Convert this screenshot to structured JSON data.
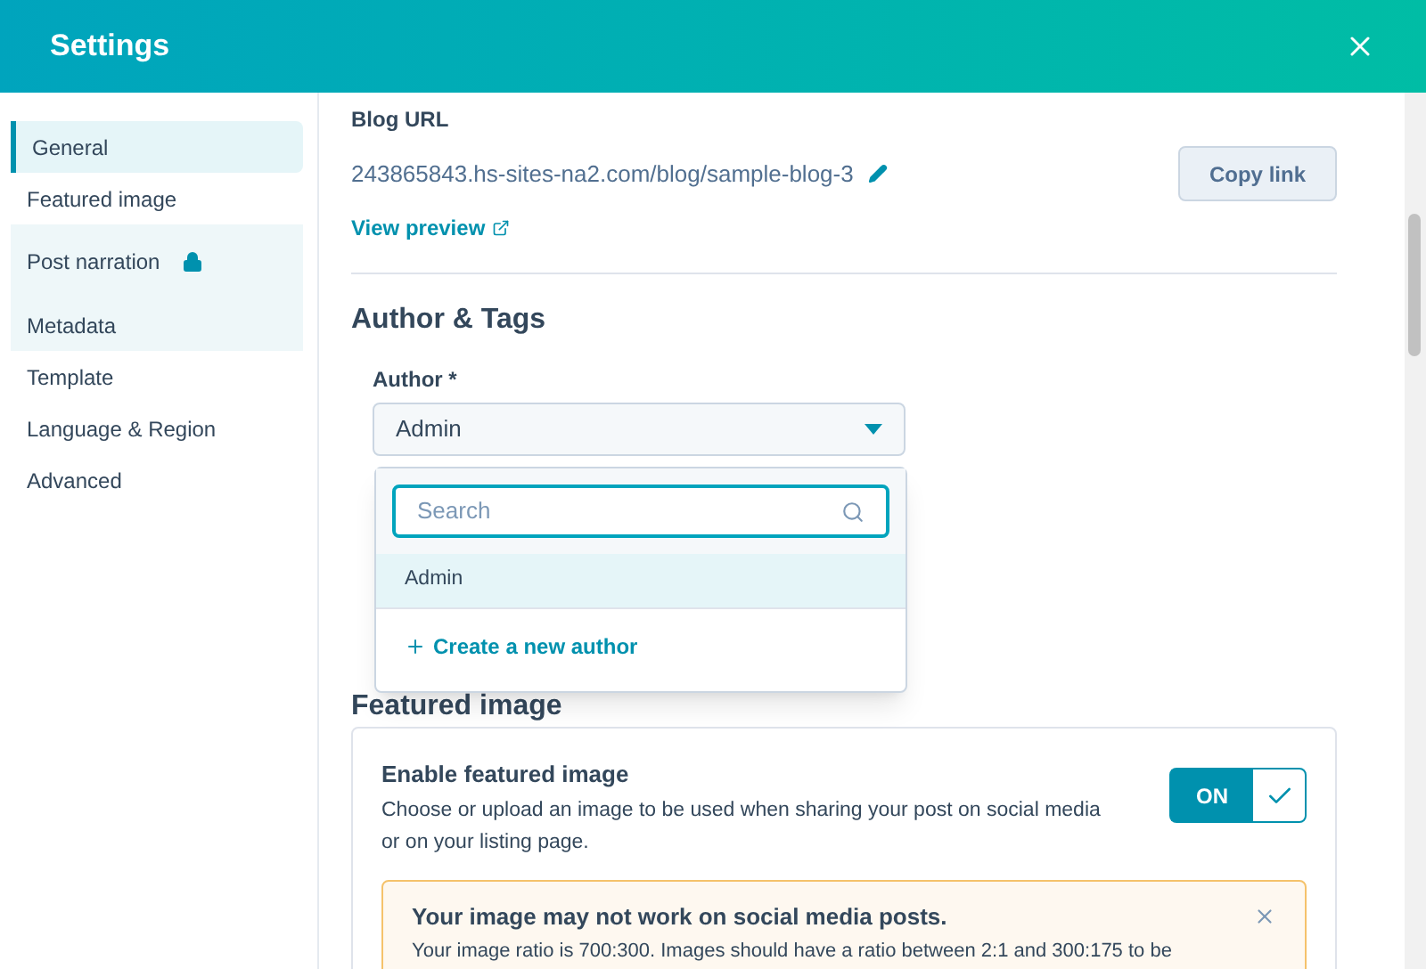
{
  "window": {
    "title": "Settings"
  },
  "sidebar": {
    "items": [
      {
        "label": "General",
        "selected": true,
        "shaded": false,
        "locked": false
      },
      {
        "label": "Featured image",
        "selected": false,
        "shaded": false,
        "locked": false
      },
      {
        "label": "Post narration",
        "selected": false,
        "shaded": true,
        "locked": true
      },
      {
        "label": "Metadata",
        "selected": false,
        "shaded": true,
        "locked": false
      },
      {
        "label": "Template",
        "selected": false,
        "shaded": false,
        "locked": false
      },
      {
        "label": "Language & Region",
        "selected": false,
        "shaded": false,
        "locked": false
      },
      {
        "label": "Advanced",
        "selected": false,
        "shaded": false,
        "locked": false
      }
    ]
  },
  "blog_url": {
    "label": "Blog URL",
    "url": "243865843.hs-sites-na2.com/blog/sample-blog-3",
    "copy_button": "Copy link",
    "preview_link": "View preview"
  },
  "author_tags": {
    "heading": "Author & Tags",
    "author_label": "Author *",
    "author_value": "Admin",
    "dropdown": {
      "search_placeholder": "Search",
      "options": [
        {
          "label": "Admin",
          "selected": true
        }
      ],
      "create_link": "Create a new author"
    }
  },
  "featured_image": {
    "heading": "Featured image",
    "enable_title": "Enable featured image",
    "enable_description": "Choose or upload an image to be used when sharing your post on social media or on your listing page.",
    "toggle": {
      "label": "ON",
      "on": true
    },
    "warning": {
      "title": "Your image may not work on social media posts.",
      "text": "Your image ratio is 700:300. Images should have a ratio between 2:1 and 300:175 to be"
    }
  }
}
